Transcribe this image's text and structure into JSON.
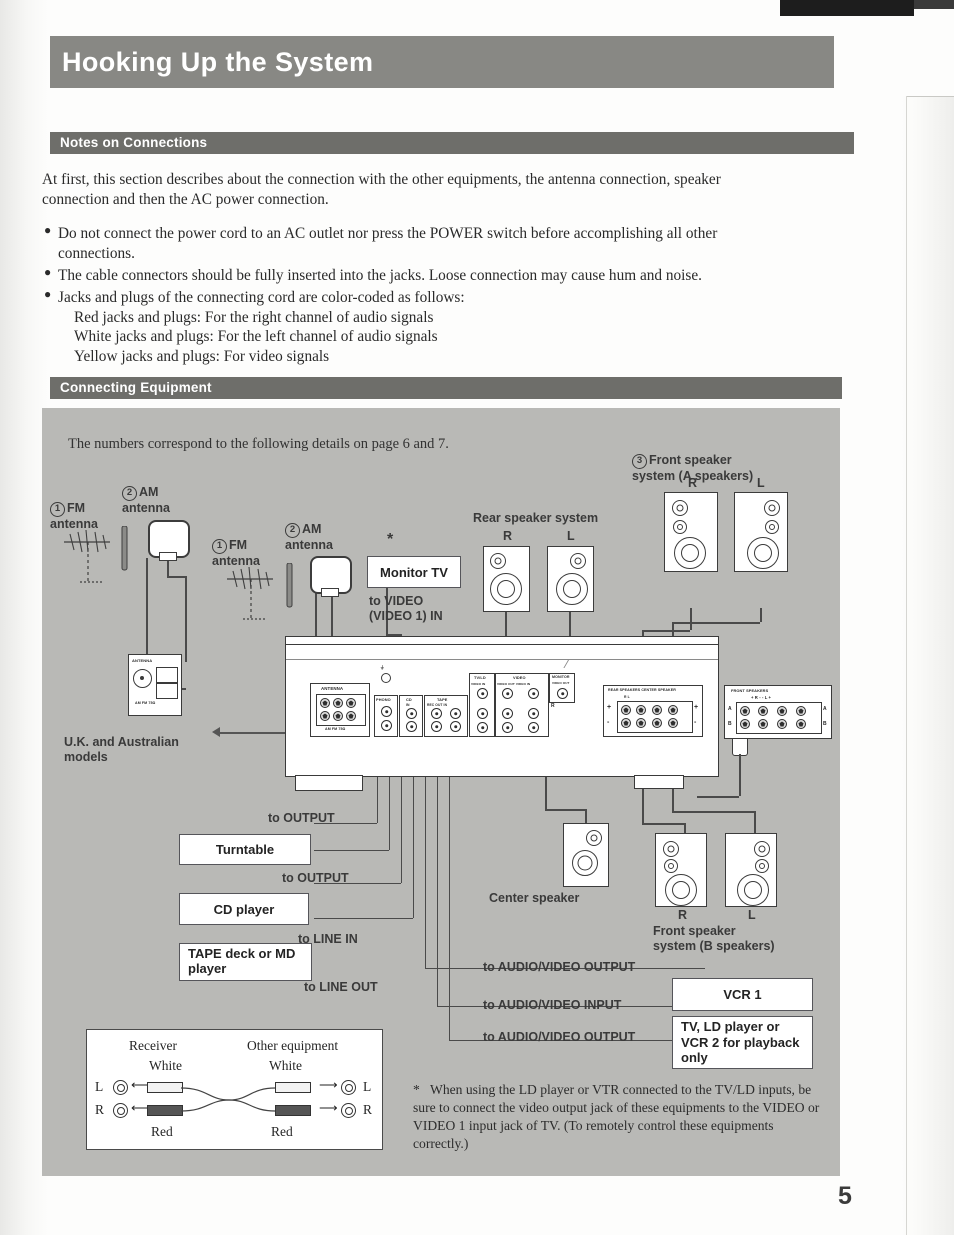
{
  "page": {
    "title": "Hooking Up the System",
    "number": "5"
  },
  "sections": {
    "notes": {
      "heading": "Notes on Connections",
      "intro": "At first, this section describes about the connection with the other equipments, the antenna connection, speaker connection and then the AC power connection.",
      "bullets": [
        "Do not connect the power cord to an AC outlet nor press the POWER switch before accomplishing all other connections.",
        "The cable connectors should be fully inserted into the jacks. Loose connection may cause hum and noise.",
        "Jacks and plugs of the connecting cord are color-coded as follows:"
      ],
      "color_code": [
        "Red jacks and plugs: For the right channel of audio signals",
        "White jacks and plugs: For the left channel of audio signals",
        "Yellow jacks and plugs: For video signals"
      ]
    },
    "connecting": {
      "heading": "Connecting Equipment",
      "note": "The numbers correspond to the following details on page 6 and 7."
    }
  },
  "diagram": {
    "antennas": {
      "fm_1": {
        "num": "1",
        "label": "FM\nantenna"
      },
      "am_1": {
        "num": "2",
        "label": "AM\nantenna"
      },
      "fm_2": {
        "num": "1",
        "label": "FM\nantenna"
      },
      "am_2": {
        "num": "2",
        "label": "AM\nantenna"
      }
    },
    "uk_models": "U.K. and Australian\nmodels",
    "monitor_tv": {
      "box": "Monitor TV",
      "asterisk": "*",
      "cable": "to VIDEO\n(VIDEO 1) IN"
    },
    "speakers": {
      "rear": {
        "title": "Rear speaker system",
        "r": "R",
        "l": "L"
      },
      "front_a": {
        "num": "3",
        "title": "Front speaker\nsystem (A speakers)",
        "r": "R",
        "l": "L"
      },
      "front_b": {
        "title": "Front speaker\nsystem (B speakers)",
        "r": "R",
        "l": "L"
      },
      "center": {
        "title": "Center speaker"
      }
    },
    "equipment": [
      {
        "box": "Turntable",
        "cable": "to OUTPUT"
      },
      {
        "box": "CD player",
        "cable": "to OUTPUT"
      },
      {
        "box": "TAPE deck or MD\nplayer",
        "cable_in": "to LINE IN",
        "cable_out": "to LINE OUT"
      }
    ],
    "video_equipment": [
      {
        "box": "VCR 1",
        "cable_top": "to AUDIO/VIDEO OUTPUT",
        "cable_bottom": "to AUDIO/VIDEO INPUT"
      },
      {
        "box": "TV, LD player or\nVCR 2 for playback\nonly",
        "cable": "to AUDIO/VIDEO OUTPUT"
      }
    ],
    "receiver_panel": {
      "antenna": "ANTENNA",
      "phono": "PHONO",
      "cd": "CD",
      "tape": "TAPE",
      "tape_sub": "REC OUT   IN",
      "tvld": "TV/LD",
      "video": "VIDEO",
      "monitor": "MONITOR",
      "tvld_sub": "VIDEO IN",
      "video_sub": "VIDEO OUT  VIDEO IN",
      "monitor_sub": "VIDEO OUT",
      "rear_center": "REAR SPEAKERS          CENTER SPEAKER",
      "rear_sub": "R         L",
      "front": "FRONT SPEAKERS",
      "front_sub": "+  R  -     -  L  +",
      "row_a": "A",
      "row_b": "B",
      "ch_l": "L",
      "ch_r": "R",
      "plus": "+",
      "minus": "-"
    },
    "legend": {
      "receiver": "Receiver",
      "other": "Other equipment",
      "white_left": "White",
      "white_right": "White",
      "red_left": "Red",
      "red_right": "Red",
      "l_left": "L",
      "r_left": "R",
      "l_right": "L",
      "r_right": "R"
    },
    "footnote": {
      "marker": "*",
      "text": "When using the LD player or VTR connected to the TV/LD inputs, be sure to connect the video output jack of these equipments to the VIDEO or VIDEO 1 input jack of TV. (To remotely control these equipments correctly.)"
    }
  },
  "colors": {
    "title_bar": "#888884",
    "section_bar": "#6e6e6a",
    "diagram_bg": "#b9b9b6",
    "line": "#4a4a4a"
  }
}
